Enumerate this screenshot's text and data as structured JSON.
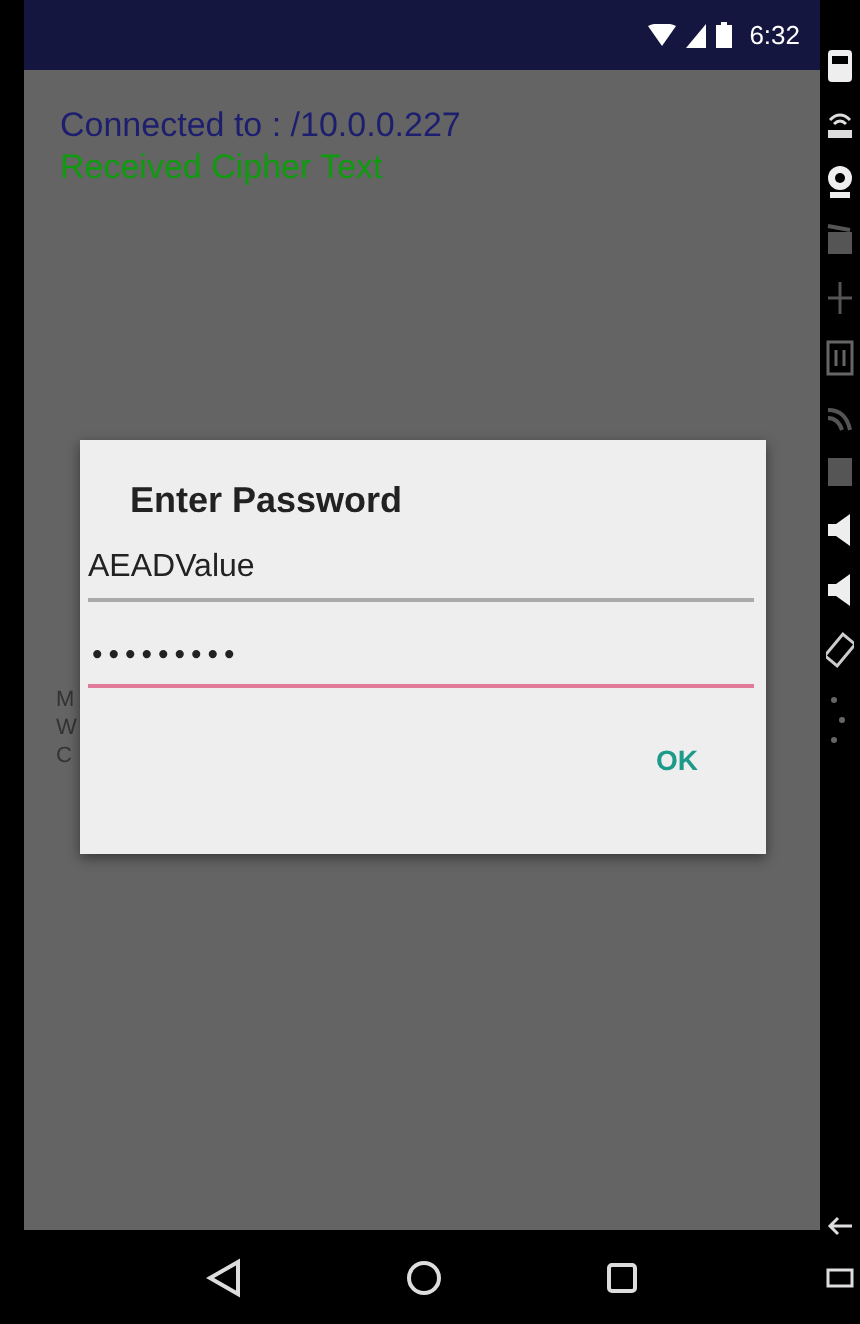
{
  "status_bar": {
    "time": "6:32"
  },
  "screen": {
    "connection": "Connected to : /10.0.0.227",
    "status": "Received Cipher Text",
    "hidden_lines": [
      "M",
      "W",
      "C"
    ]
  },
  "dialog": {
    "title": "Enter Password",
    "fields": [
      {
        "kind": "text",
        "value": "AEADValue",
        "focused": false
      },
      {
        "kind": "password",
        "value": "•••••••••",
        "focused": true
      }
    ],
    "buttons": [
      "OK"
    ]
  }
}
